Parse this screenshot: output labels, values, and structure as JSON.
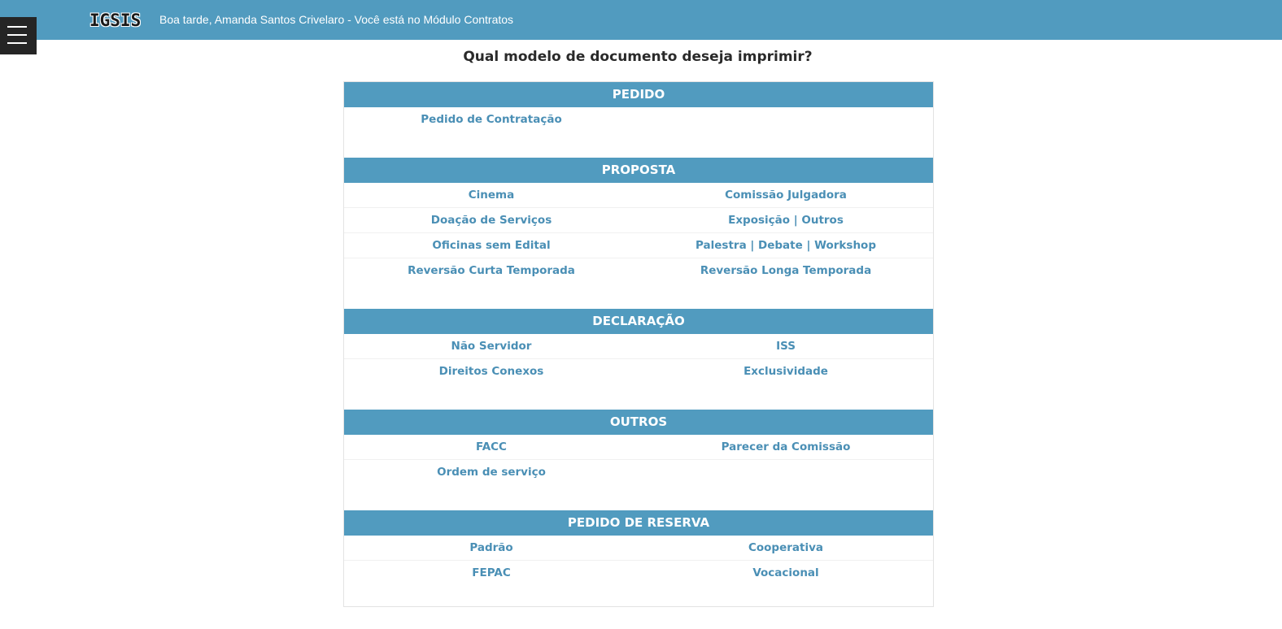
{
  "header": {
    "logo": "IGSIS",
    "greeting": "Boa tarde, Amanda Santos Crivelaro - Você está no Módulo Contratos",
    "background_color": "#519bbf",
    "menu_icon": "hamburger-menu-icon"
  },
  "page": {
    "title": "Qual modelo de documento deseja imprimir?"
  },
  "sections": [
    {
      "title": "PEDIDO",
      "rows": [
        [
          "Pedido de Contratação",
          ""
        ]
      ]
    },
    {
      "title": "PROPOSTA",
      "rows": [
        [
          "Cinema",
          "Comissão Julgadora"
        ],
        [
          "Doação de Serviços",
          "Exposição | Outros"
        ],
        [
          "Oficinas sem Edital",
          "Palestra | Debate | Workshop"
        ],
        [
          "Reversão Curta Temporada",
          "Reversão Longa Temporada"
        ]
      ]
    },
    {
      "title": "DECLARAÇÃO",
      "rows": [
        [
          "Não Servidor",
          "ISS"
        ],
        [
          "Direitos Conexos",
          "Exclusividade"
        ]
      ]
    },
    {
      "title": "OUTROS",
      "rows": [
        [
          "FACC",
          "Parecer da Comissão"
        ],
        [
          "Ordem de serviço",
          ""
        ]
      ]
    },
    {
      "title": "PEDIDO DE RESERVA",
      "rows": [
        [
          "Padrão",
          "Cooperativa"
        ],
        [
          "FEPAC",
          "Vocacional"
        ]
      ]
    }
  ],
  "colors": {
    "accent": "#519bbf",
    "link": "#4a8fb5",
    "menu_button": "#252525"
  }
}
